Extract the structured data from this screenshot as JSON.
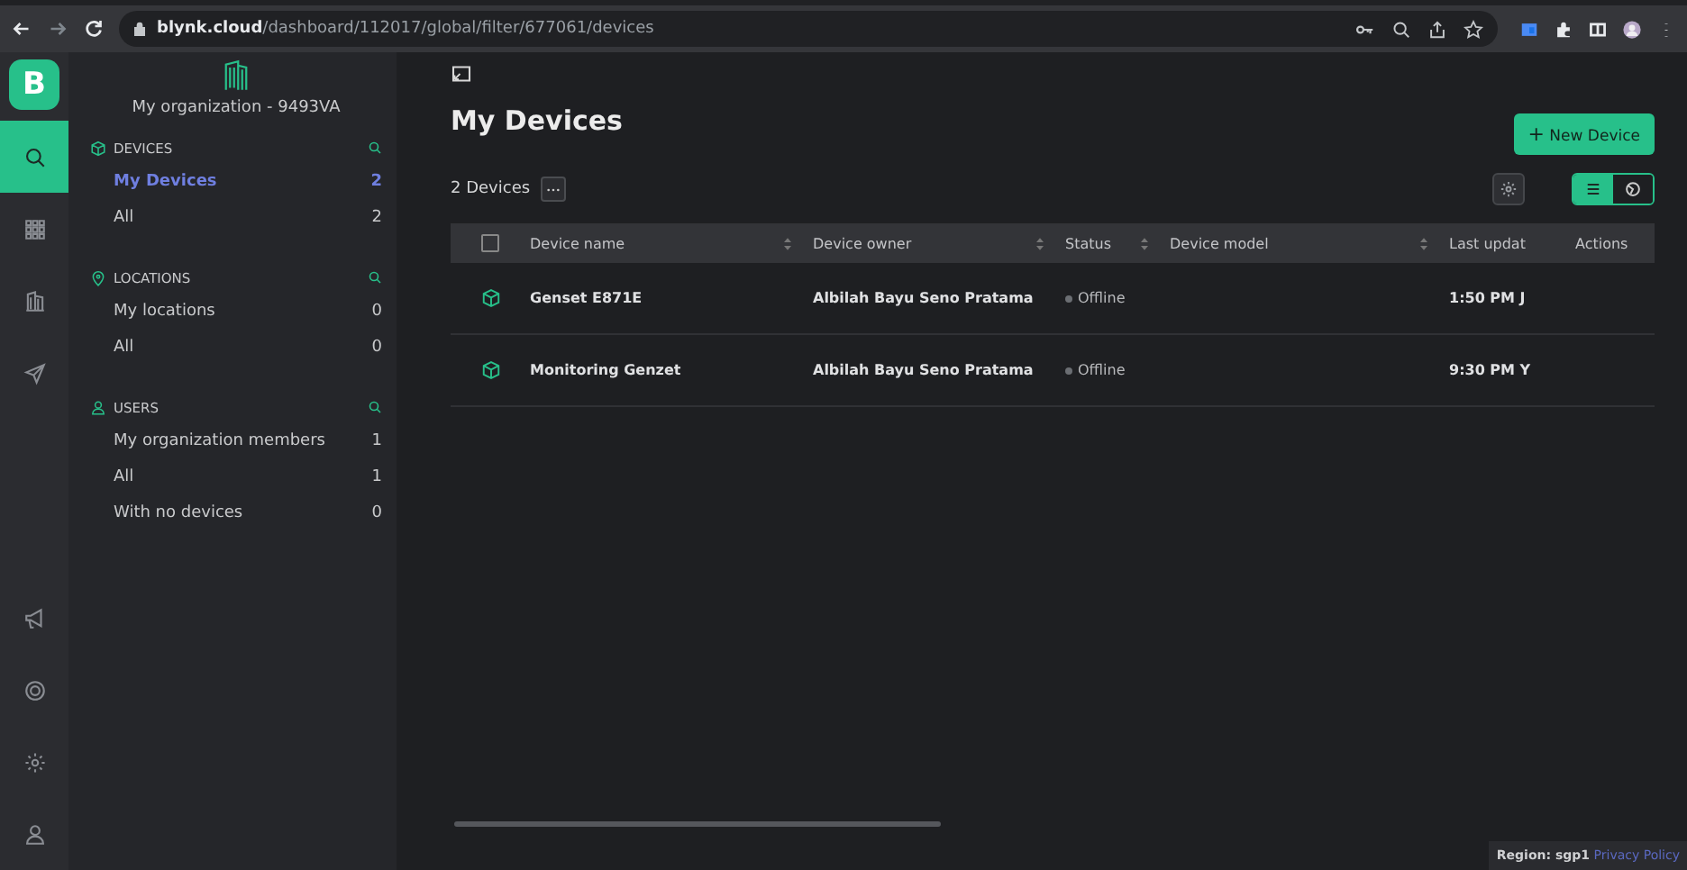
{
  "browser": {
    "url_host": "blynk.cloud",
    "url_path": "/dashboard/112017/global/filter/677061/devices"
  },
  "rail": {
    "logo": "B",
    "items": [
      {
        "selected": true
      },
      {
        "selected": false
      },
      {
        "selected": false
      },
      {
        "selected": false
      }
    ],
    "bottom": [
      {
        "selected": false
      },
      {
        "selected": false
      },
      {
        "selected": false
      },
      {
        "selected": false
      }
    ]
  },
  "sidebar": {
    "organization": "My organization - 9493VA",
    "sections": [
      {
        "title": "DEVICES",
        "items": [
          {
            "label": "My Devices",
            "count": "2",
            "selected": true
          },
          {
            "label": "All",
            "count": "2",
            "selected": false
          }
        ]
      },
      {
        "title": "LOCATIONS",
        "items": [
          {
            "label": "My locations",
            "count": "0",
            "selected": false
          },
          {
            "label": "All",
            "count": "0",
            "selected": false
          }
        ]
      },
      {
        "title": "USERS",
        "items": [
          {
            "label": "My organization members",
            "count": "1",
            "selected": false
          },
          {
            "label": "All",
            "count": "1",
            "selected": false
          },
          {
            "label": "With no devices",
            "count": "0",
            "selected": false
          }
        ]
      }
    ]
  },
  "main": {
    "title": "My Devices",
    "new_button": "New Device",
    "new_button_icon": "+",
    "device_count": "2 Devices",
    "view_toggle": [
      {
        "selected": true
      },
      {
        "selected": false
      }
    ]
  },
  "table": {
    "select_all_checked": false,
    "columns": [
      "Device name",
      "Device owner",
      "Status",
      "Device model",
      "Last updat",
      "Actions"
    ],
    "rows": [
      {
        "name": "Genset E871E",
        "owner": "Albilah Bayu Seno Pratama",
        "status": "Offline",
        "online": false,
        "last_update": "1:50 PM J"
      },
      {
        "name": "Monitoring Genzet",
        "owner": "Albilah Bayu Seno Pratama",
        "status": "Offline",
        "online": false,
        "last_update": "9:30 PM Y"
      }
    ]
  },
  "footer": {
    "region": "Region: sgp1",
    "privacy": "Privacy Policy"
  }
}
